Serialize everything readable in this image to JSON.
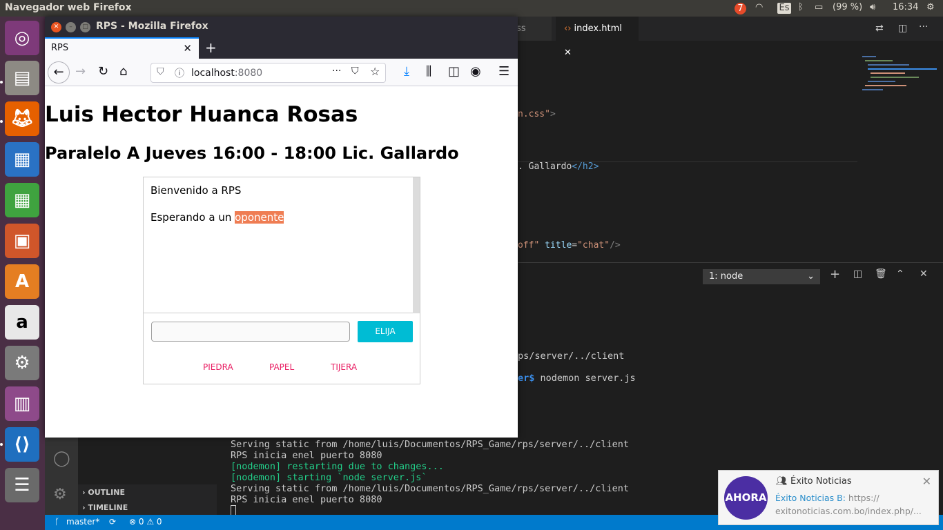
{
  "topbar": {
    "app_title": "Navegador web Firefox",
    "notification_count": "7",
    "keyboard_layout": "Es",
    "battery": "(99 %)",
    "time": "16:34"
  },
  "launcher": {
    "items": [
      "ubuntu-dash",
      "files",
      "firefox",
      "writer",
      "calc",
      "impress",
      "software",
      "amazon",
      "settings",
      "workspace",
      "vscode",
      "stacked-windows"
    ]
  },
  "vscode": {
    "tabs": [
      "css",
      "index.html"
    ],
    "code": {
      "line1_str": "n.css\"",
      "line1_rest": ">",
      "line2_text": ". Gallardo",
      "line2_tag": "</h2>",
      "line3_str": "off\"",
      "line3_attr": "title",
      "line3_val": "\"chat\"",
      "line3_end": "/>"
    },
    "terminal_select": "1: node",
    "terminal": {
      "l1": "ps/server/../client",
      "l2_prompt": "er$",
      "l2_cmd": " nodemon server.js",
      "l3": "Serving static from /home/luis/Documentos/RPS_Game/rps/server/../client",
      "l4": "RPS inicia enel puerto 8080",
      "l5": "[nodemon] restarting due to changes...",
      "l6": "[nodemon] starting `node server.js`",
      "l7": "Serving static from /home/luis/Documentos/RPS_Game/rps/server/../client",
      "l8": "RPS inicia enel puerto 8080"
    },
    "sidebar_sections": [
      "OUTLINE",
      "TIMELINE"
    ],
    "statusbar": {
      "branch": "master*",
      "problems": "⊗ 0 ⚠ 0"
    }
  },
  "firefox": {
    "window_title": "RPS - Mozilla Firefox",
    "tab_label": "RPS",
    "url_host": "localhost",
    "url_port": ":8080"
  },
  "page": {
    "title": "Luis Hector Huanca Rosas",
    "subtitle": "Paralelo A Jueves 16:00 - 18:00 Lic. Gallardo",
    "chat": {
      "msg1": "Bienvenido a RPS",
      "msg2_prefix": "Esperando a un ",
      "msg2_highlight": "oponente",
      "input_value": "",
      "submit_label": "ELIJA",
      "choices": [
        "PIEDRA",
        "PAPEL",
        "TIJERA"
      ]
    }
  },
  "notification": {
    "logo_text": "AHORA",
    "title": "Éxito Noticias",
    "source": "Éxito Noticias B:",
    "body": " https:// exitonoticias.com.bo/index.php/..."
  },
  "colors": {
    "accent_button": "#00bcd4",
    "choice_text": "#e91e63",
    "highlight": "#ef7d53",
    "vscode_status": "#007acc"
  }
}
